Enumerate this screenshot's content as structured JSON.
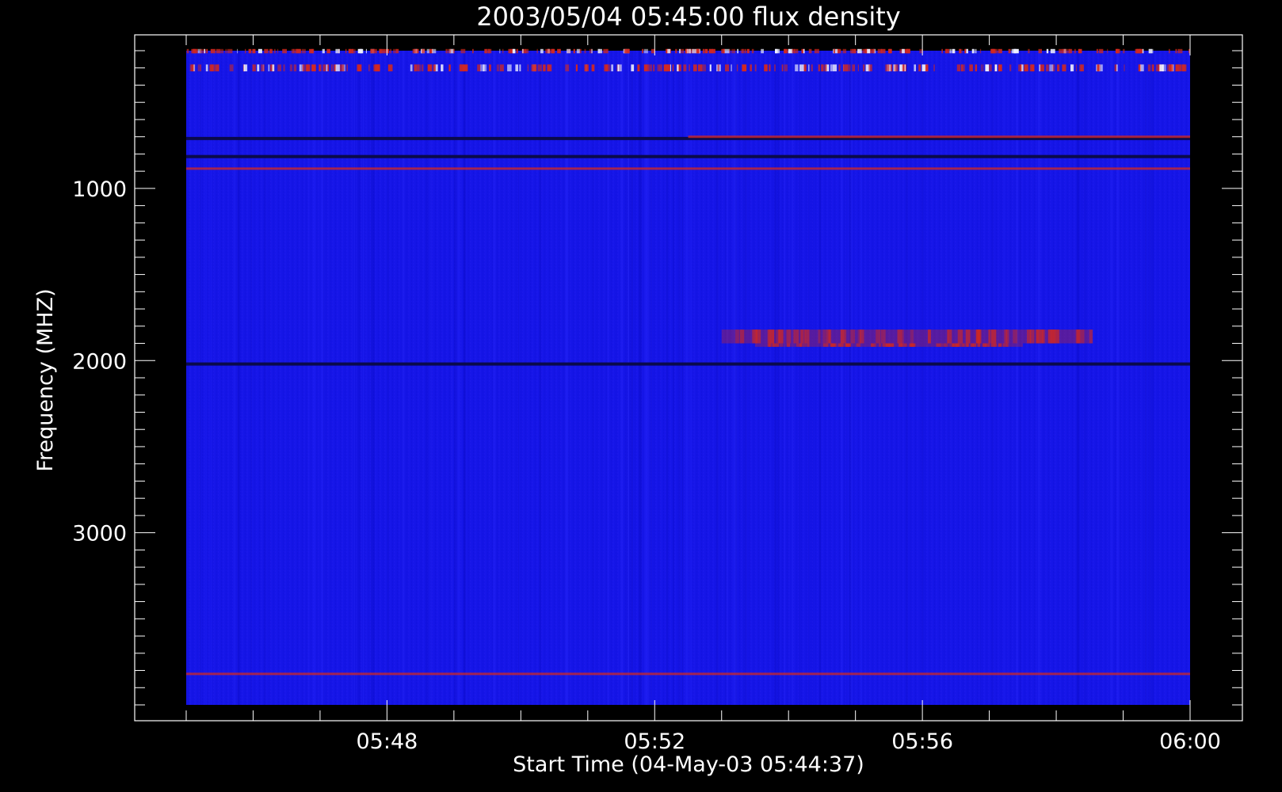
{
  "chart_data": {
    "type": "heatmap",
    "title": "2003/05/04 05:45:00 flux density",
    "xlabel": "Start Time (04-May-03 05:44:37)",
    "ylabel": "Frequency (MHZ)",
    "x_axis": {
      "unit": "time",
      "data_start": "05:45:00",
      "data_end": "06:00:00",
      "range": [
        "05:44:37",
        "06:00:00"
      ],
      "tick_labels": [
        "05:48",
        "05:52",
        "05:56",
        "06:00"
      ],
      "major_ticks": [
        "05:48",
        "05:52",
        "05:56",
        "06:00"
      ]
    },
    "y_axis": {
      "unit": "MHz",
      "inverted": true,
      "range": [
        100,
        4000
      ],
      "data_range": [
        200,
        4000
      ],
      "tick_labels": [
        "1000",
        "2000",
        "3000"
      ],
      "major_ticks": [
        1000,
        2000,
        3000
      ]
    },
    "colorscale": {
      "background": "#1414e6",
      "low": "#0a0a4a",
      "mid": "#1e1ef5",
      "high": "#d22820"
    },
    "grid": false,
    "legend": "none",
    "features": [
      {
        "kind": "bursty-band",
        "freq_mhz": [
          280,
          320
        ],
        "time": [
          "05:45:00",
          "06:00:00"
        ],
        "level": "high"
      },
      {
        "kind": "bursty-band",
        "freq_mhz": [
          190,
          215
        ],
        "time": [
          "05:45:00",
          "06:00:00"
        ],
        "level": "high"
      },
      {
        "kind": "dark-line",
        "freq_mhz": 710,
        "time": [
          "05:45:00",
          "06:00:00"
        ]
      },
      {
        "kind": "dark-line",
        "freq_mhz": 815,
        "time": [
          "05:45:00",
          "06:00:00"
        ]
      },
      {
        "kind": "red-line",
        "freq_mhz": 700,
        "time": [
          "05:52:30",
          "06:00:00"
        ]
      },
      {
        "kind": "red-line",
        "freq_mhz": 885,
        "time": [
          "05:45:00",
          "06:00:00"
        ]
      },
      {
        "kind": "emission-band",
        "freq_mhz": [
          1820,
          1900
        ],
        "time": [
          "05:53:00",
          "05:58:30"
        ],
        "level": "high"
      },
      {
        "kind": "emission-band",
        "freq_mhz": [
          1900,
          1920
        ],
        "time": [
          "05:53:30",
          "05:57:30"
        ],
        "level": "high"
      },
      {
        "kind": "dark-line",
        "freq_mhz": 2020,
        "time": [
          "05:45:00",
          "06:00:00"
        ]
      },
      {
        "kind": "red-line",
        "freq_mhz": 3820,
        "time": [
          "05:45:00",
          "06:00:00"
        ]
      }
    ]
  }
}
